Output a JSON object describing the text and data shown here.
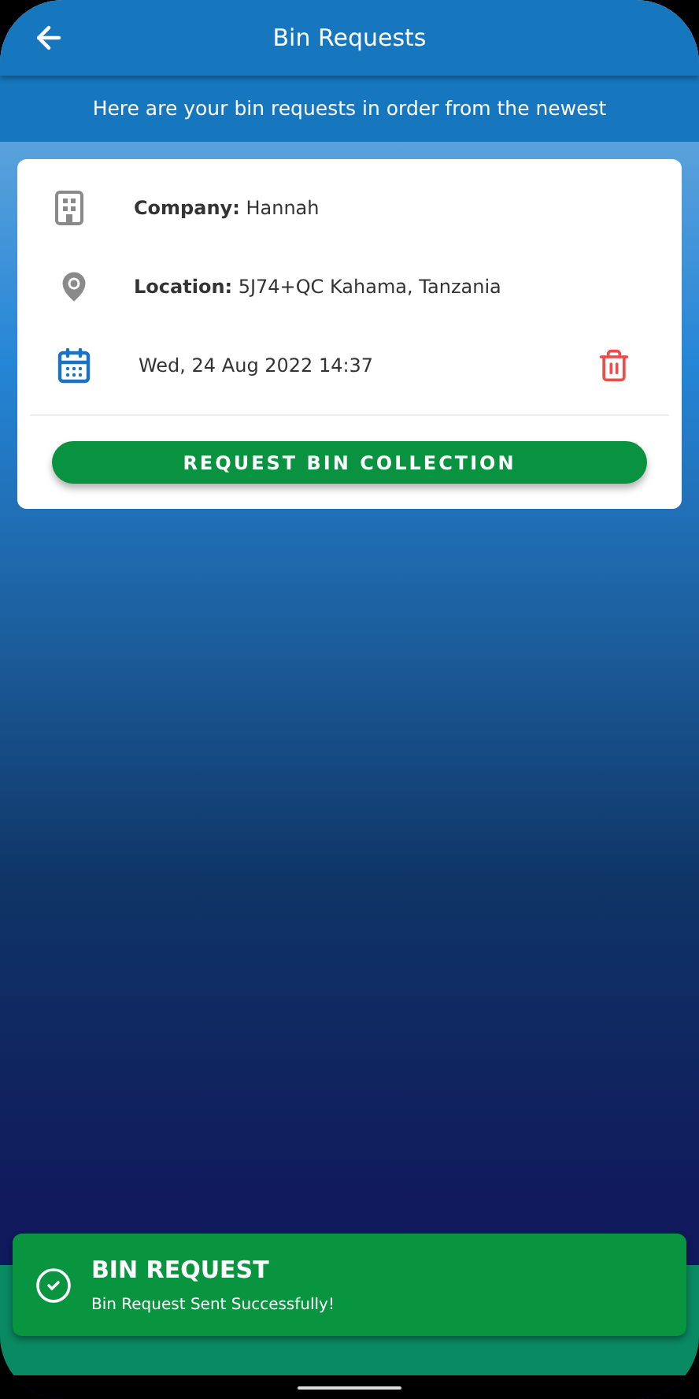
{
  "header": {
    "title": "Bin Requests"
  },
  "subtitle": "Here are your bin requests in order from the newest",
  "requests": [
    {
      "details": [
        {
          "kind": "company",
          "text": "**Company:** Hannah"
        },
        {
          "kind": "location",
          "text": "**Location:** 5J74+QC Kahama, Tanzania"
        },
        {
          "kind": "date",
          "text": "Wed, 24 Aug 2022 14:37"
        }
      ],
      "button": "REQUEST BIN COLLECTION"
    }
  ],
  "toast": {
    "title": "BIN REQUEST",
    "message": "Bin Request Sent Successfully!"
  }
}
